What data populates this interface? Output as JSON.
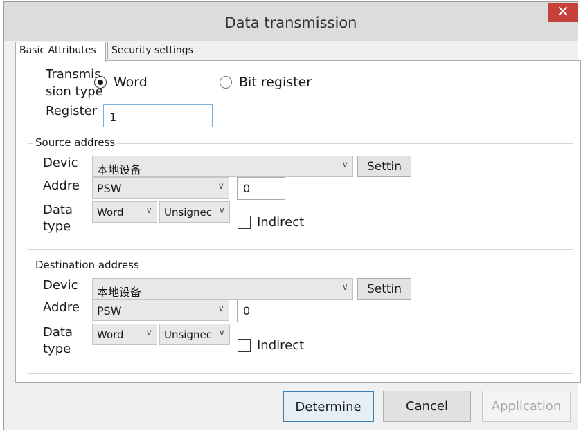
{
  "window": {
    "title": "Data transmission",
    "close_glyph": "✕"
  },
  "tabs": [
    {
      "label": "Basic Attributes",
      "active": true
    },
    {
      "label": "Security settings",
      "active": false
    }
  ],
  "transmission": {
    "label_line1": "Transmis",
    "label_line2": "sion type",
    "options": [
      {
        "label": "Word",
        "checked": true
      },
      {
        "label": "Bit register",
        "checked": false
      }
    ],
    "register_label": "Register",
    "register_value": "1"
  },
  "source": {
    "group_label": "Source address",
    "device_label": "Devic",
    "device_value": "本地设备",
    "setting_label": "Settin",
    "address_label": "Addre",
    "address_select": "PSW",
    "address_value": "0",
    "datatype_label_line1": "Data",
    "datatype_label_line2": "type",
    "datatype_select": "Word",
    "sign_select": "Unsignec",
    "indirect_label": "Indirect"
  },
  "destination": {
    "group_label": "Destination address",
    "device_label": "Devic",
    "device_value": "本地设备",
    "setting_label": "Settin",
    "address_label": "Addre",
    "address_select": "PSW",
    "address_value": "0",
    "datatype_label_line1": "Data",
    "datatype_label_line2": "type",
    "datatype_select": "Word",
    "sign_select": "Unsignec",
    "indirect_label": "Indirect"
  },
  "footer": {
    "determine_label": "Determine",
    "cancel_label": "Cancel",
    "application_label": "Application"
  },
  "chevron_glyph": "∨",
  "colors": {
    "close": "#c7413b",
    "focus_border": "#3c7fb1",
    "disabled_text": "#a8a8a8"
  }
}
